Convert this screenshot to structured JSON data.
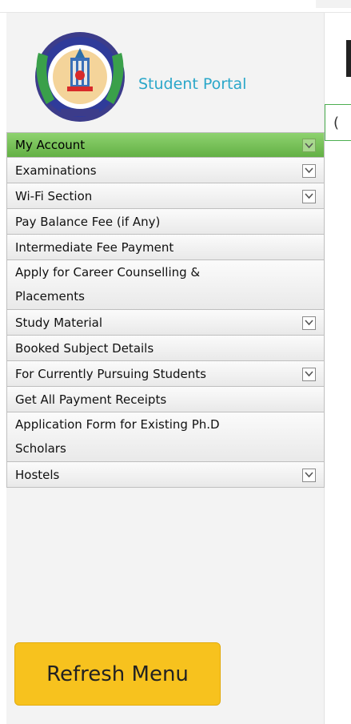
{
  "portal": {
    "brand": "Student Portal"
  },
  "menu": {
    "items": [
      {
        "label": "My Account",
        "expandable": true
      },
      {
        "label": "Examinations",
        "expandable": true
      },
      {
        "label": "Wi-Fi Section",
        "expandable": true
      },
      {
        "label": "Pay Balance Fee (if Any)",
        "expandable": false
      },
      {
        "label": "Intermediate Fee Payment",
        "expandable": false
      },
      {
        "label": "Apply for Career Counselling & Placements",
        "expandable": false
      },
      {
        "label": "Study Material",
        "expandable": true
      },
      {
        "label": "Booked Subject Details",
        "expandable": false
      },
      {
        "label": "For Currently Pursuing Students",
        "expandable": true
      },
      {
        "label": "Get All Payment Receipts",
        "expandable": false
      },
      {
        "label": "Application Form for Existing Ph.D Scholars",
        "expandable": false
      },
      {
        "label": "Hostels",
        "expandable": true
      }
    ],
    "refresh_label": "Refresh Menu"
  },
  "main": {
    "box_char": "("
  },
  "colors": {
    "active_item": "#63b045",
    "brand_text": "#2aa7c9",
    "refresh_button": "#f7c21e"
  },
  "icons": {
    "expand": "chevron-down-icon",
    "logo": "university-emblem-icon"
  }
}
